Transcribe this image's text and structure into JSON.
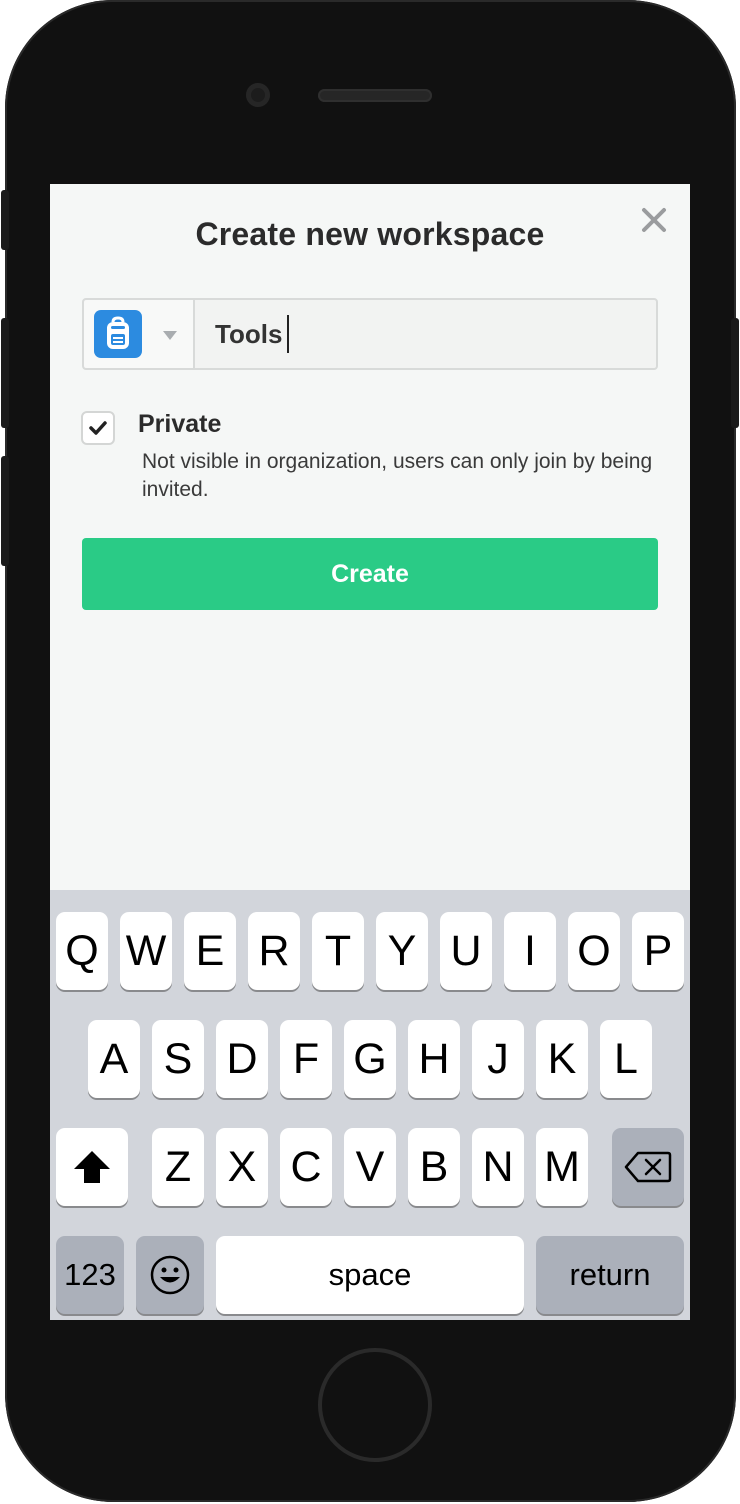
{
  "dialog": {
    "title": "Create new workspace",
    "close_icon": "close-icon",
    "workspace_icon": "backpack-icon",
    "workspace_icon_color": "#2c8be0",
    "name_value": "Tools",
    "private_checked": true,
    "private_label": "Private",
    "private_description": "Not visible in organization, users can only join by being invited.",
    "create_label": "Create",
    "create_color": "#2acb86"
  },
  "keyboard": {
    "row1": [
      "Q",
      "W",
      "E",
      "R",
      "T",
      "Y",
      "U",
      "I",
      "O",
      "P"
    ],
    "row2": [
      "A",
      "S",
      "D",
      "F",
      "G",
      "H",
      "J",
      "K",
      "L"
    ],
    "row3": [
      "Z",
      "X",
      "C",
      "V",
      "B",
      "N",
      "M"
    ],
    "shift_icon": "shift-icon",
    "backspace_icon": "backspace-icon",
    "numbers_label": "123",
    "emoji_icon": "emoji-icon",
    "space_label": "space",
    "return_label": "return"
  }
}
